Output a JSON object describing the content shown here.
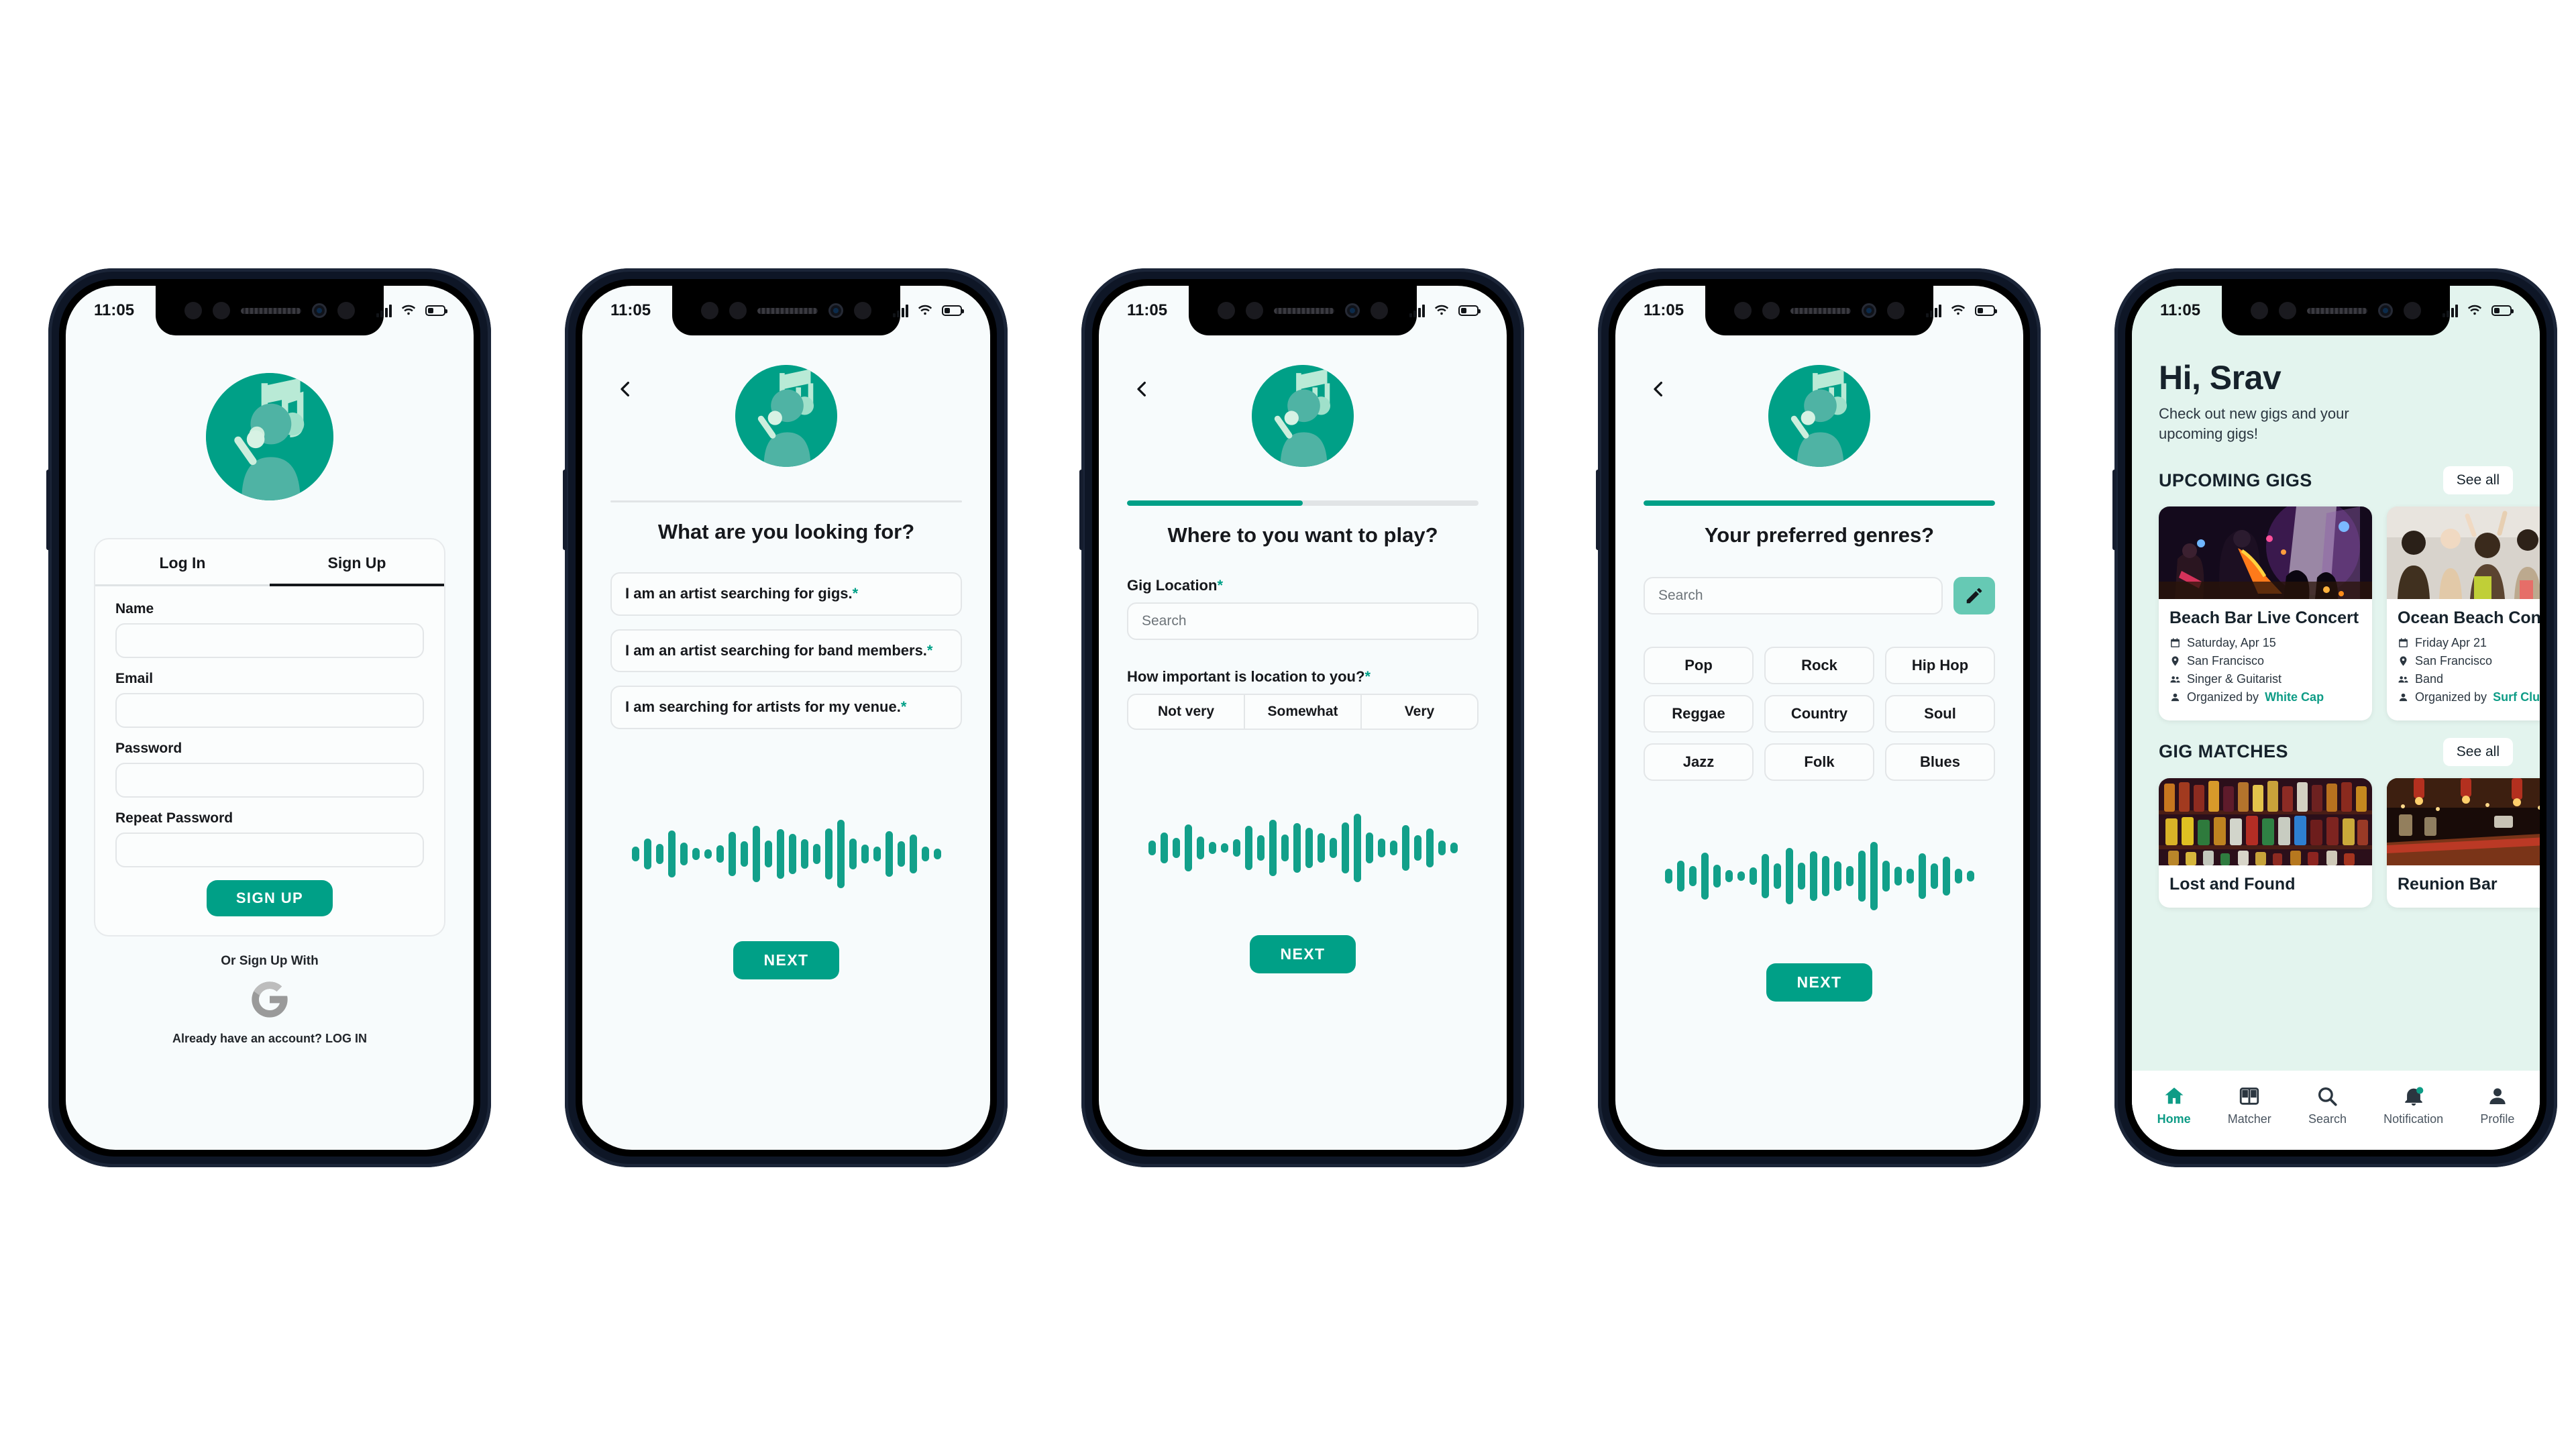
{
  "colors": {
    "accent": "#00a087",
    "accent_light": "#66c9b4",
    "mint_bg": "#e3f4ee",
    "screen_bg": "#f7fbfc",
    "text": "#16181c",
    "muted": "#6d7479"
  },
  "status_bar": {
    "time": "11:05",
    "signal_icon": "signal-bars-icon",
    "wifi_icon": "wifi-icon",
    "battery_icon": "battery-icon"
  },
  "screens": [
    {
      "id": "signup",
      "logo_icon": "app-logo-singer-music-note",
      "tabs": [
        {
          "label": "Log In",
          "active": false
        },
        {
          "label": "Sign Up",
          "active": true
        }
      ],
      "fields": [
        {
          "label": "Name",
          "value": "",
          "placeholder": ""
        },
        {
          "label": "Email",
          "value": "",
          "placeholder": ""
        },
        {
          "label": "Password",
          "value": "",
          "placeholder": ""
        },
        {
          "label": "Repeat Password",
          "value": "",
          "placeholder": ""
        }
      ],
      "submit_label": "SIGN UP",
      "or_text": "Or Sign Up With",
      "google_icon": "google-g-icon",
      "footer_text": "Already have an account? LOG IN"
    },
    {
      "id": "looking-for",
      "back_icon": "chevron-left-icon",
      "logo_icon": "app-logo-singer-music-note",
      "progress": 0,
      "title": "What are you looking for?",
      "options": [
        {
          "text": "I am an artist searching for gigs.",
          "required": "*"
        },
        {
          "text": "I am an artist searching for band members.",
          "required": "*"
        },
        {
          "text": "I am searching for artists for my venue.",
          "required": "*"
        }
      ],
      "waveform_icon": "audio-waveform",
      "next_label": "NEXT"
    },
    {
      "id": "location",
      "back_icon": "chevron-left-icon",
      "logo_icon": "app-logo-singer-music-note",
      "progress": 50,
      "title": "Where to you want to play?",
      "location_label": "Gig Location",
      "location_required": "*",
      "location_placeholder": "Search",
      "importance_label": "How important is location to you?",
      "importance_required": "*",
      "importance_options": [
        "Not very",
        "Somewhat",
        "Very"
      ],
      "waveform_icon": "audio-waveform",
      "next_label": "NEXT"
    },
    {
      "id": "genres",
      "back_icon": "chevron-left-icon",
      "logo_icon": "app-logo-singer-music-note",
      "progress": 100,
      "title": "Your preferred genres?",
      "search_placeholder": "Search",
      "edit_icon": "pencil-edit-icon",
      "genres": [
        "Pop",
        "Rock",
        "Hip Hop",
        "Reggae",
        "Country",
        "Soul",
        "Jazz",
        "Folk",
        "Blues"
      ],
      "waveform_icon": "audio-waveform",
      "next_label": "NEXT"
    },
    {
      "id": "home",
      "greeting": "Hi, Srav",
      "subtitle": "Check out new gigs and your upcoming gigs!",
      "sections": [
        {
          "title": "UPCOMING GIGS",
          "see_all_label": "See all",
          "cards": [
            {
              "title": "Beach Bar Live Concert",
              "date": "Saturday, Apr 15",
              "date_icon": "calendar-icon",
              "location": "San Francisco",
              "location_icon": "map-pin-icon",
              "roles": "Singer & Guitarist",
              "roles_icon": "people-group-icon",
              "organizer_prefix": "Organized by",
              "organizer": "White Cap",
              "organizer_icon": "person-icon"
            },
            {
              "title": "Ocean Beach Concert",
              "date": "Friday Apr 21",
              "date_icon": "calendar-icon",
              "location": "San Francisco",
              "location_icon": "map-pin-icon",
              "roles": "Band",
              "roles_icon": "people-group-icon",
              "organizer_prefix": "Organized by",
              "organizer": "Surf Club",
              "organizer_icon": "person-icon"
            }
          ]
        },
        {
          "title": "GIG MATCHES",
          "see_all_label": "See all",
          "cards": [
            {
              "title": "Lost and Found"
            },
            {
              "title": "Reunion Bar"
            }
          ]
        }
      ],
      "nav": [
        {
          "label": "Home",
          "icon": "home-icon",
          "active": true
        },
        {
          "label": "Matcher",
          "icon": "matcher-cards-icon",
          "active": false
        },
        {
          "label": "Search",
          "icon": "search-icon",
          "active": false
        },
        {
          "label": "Notification",
          "icon": "bell-icon",
          "active": false,
          "has_badge": true
        },
        {
          "label": "Profile",
          "icon": "person-icon",
          "active": false
        }
      ]
    }
  ],
  "waveform_heights": [
    22,
    46,
    30,
    70,
    34,
    18,
    14,
    26,
    66,
    38,
    84,
    40,
    74,
    60,
    44,
    30,
    76,
    102,
    46,
    28,
    22,
    68,
    38,
    58,
    22,
    16
  ]
}
